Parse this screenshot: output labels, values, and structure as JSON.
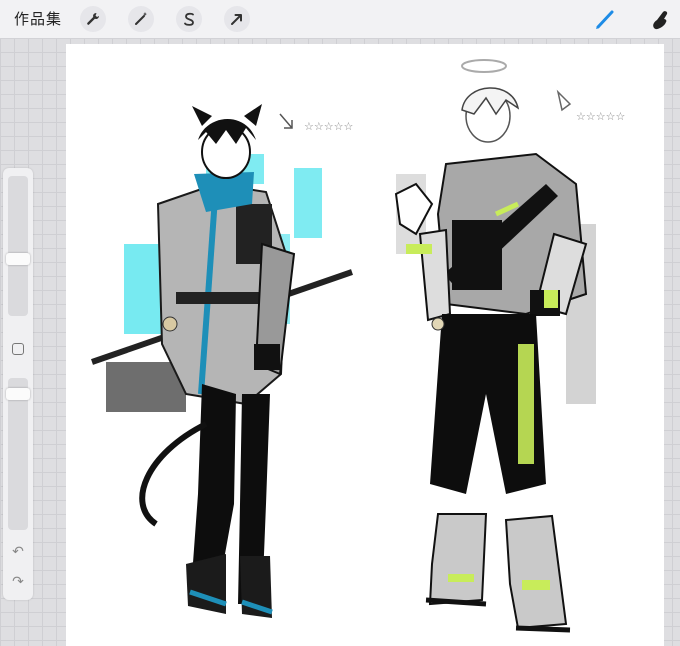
{
  "topbar": {
    "gallery_label": "作品集",
    "tools": [
      {
        "name": "actions",
        "icon": "wrench-icon"
      },
      {
        "name": "adjustments",
        "icon": "magic-wand-icon"
      },
      {
        "name": "selection",
        "icon": "selection-s-icon"
      },
      {
        "name": "transform",
        "icon": "arrow-cursor-icon"
      }
    ],
    "right_tools": [
      {
        "name": "brush",
        "icon": "brush-icon",
        "active": true,
        "color": "#1e8ce6"
      },
      {
        "name": "smudge",
        "icon": "smudge-finger-icon"
      }
    ]
  },
  "sidebar": {
    "brush_size_level": 0.15,
    "opacity_level": 0.08,
    "undo_icon": "undo-icon",
    "redo_icon": "redo-icon"
  },
  "colors": {
    "accent_cyan": "#5fe6ef",
    "accent_blue": "#1e8fb8",
    "accent_lime": "#c8ec5a",
    "ink": "#111111",
    "gray": "#9a9a9a"
  }
}
